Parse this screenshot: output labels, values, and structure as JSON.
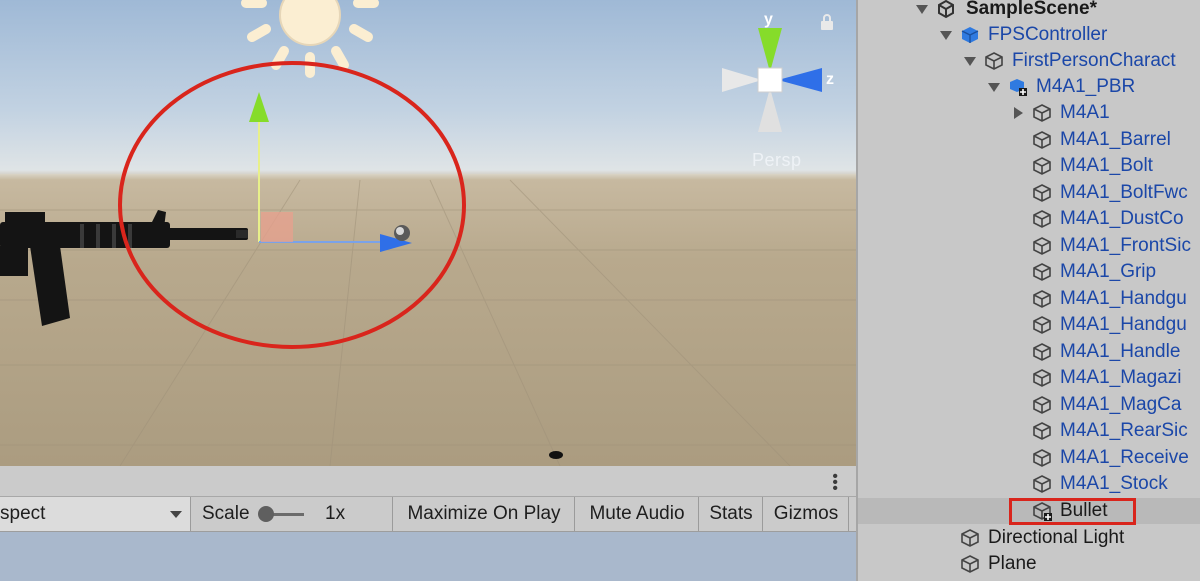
{
  "scene_view": {
    "projection_label": "Persp",
    "gizmo_axes": {
      "y": "y",
      "z": "z"
    }
  },
  "game_view": {
    "aspect_label": "spect",
    "scale_label": "Scale",
    "scale_value": "1x",
    "buttons": [
      "Maximize On Play",
      "Mute Audio",
      "Stats",
      "Gizmos"
    ]
  },
  "hierarchy": {
    "scene_name": "SampleScene*",
    "items": [
      {
        "label": "FPSController"
      },
      {
        "label": "FirstPersonCharact"
      },
      {
        "label": "M4A1_PBR"
      },
      {
        "label": "M4A1"
      },
      {
        "label": "M4A1_Barrel"
      },
      {
        "label": "M4A1_Bolt"
      },
      {
        "label": "M4A1_BoltFwc"
      },
      {
        "label": "M4A1_DustCo"
      },
      {
        "label": "M4A1_FrontSic"
      },
      {
        "label": "M4A1_Grip"
      },
      {
        "label": "M4A1_Handgu"
      },
      {
        "label": "M4A1_Handgu"
      },
      {
        "label": "M4A1_Handle"
      },
      {
        "label": "M4A1_Magazi"
      },
      {
        "label": "M4A1_MagCa"
      },
      {
        "label": "M4A1_RearSic"
      },
      {
        "label": "M4A1_Receive"
      },
      {
        "label": "M4A1_Stock"
      },
      {
        "label": "Bullet"
      },
      {
        "label": "Directional Light"
      },
      {
        "label": "Plane"
      }
    ]
  },
  "colors": {
    "highlight_circle": "#d9251c",
    "hierarchy_text_prefab": "#1b47a8",
    "gizmo_y": "#7ed321",
    "gizmo_z": "#2f6fe8"
  }
}
